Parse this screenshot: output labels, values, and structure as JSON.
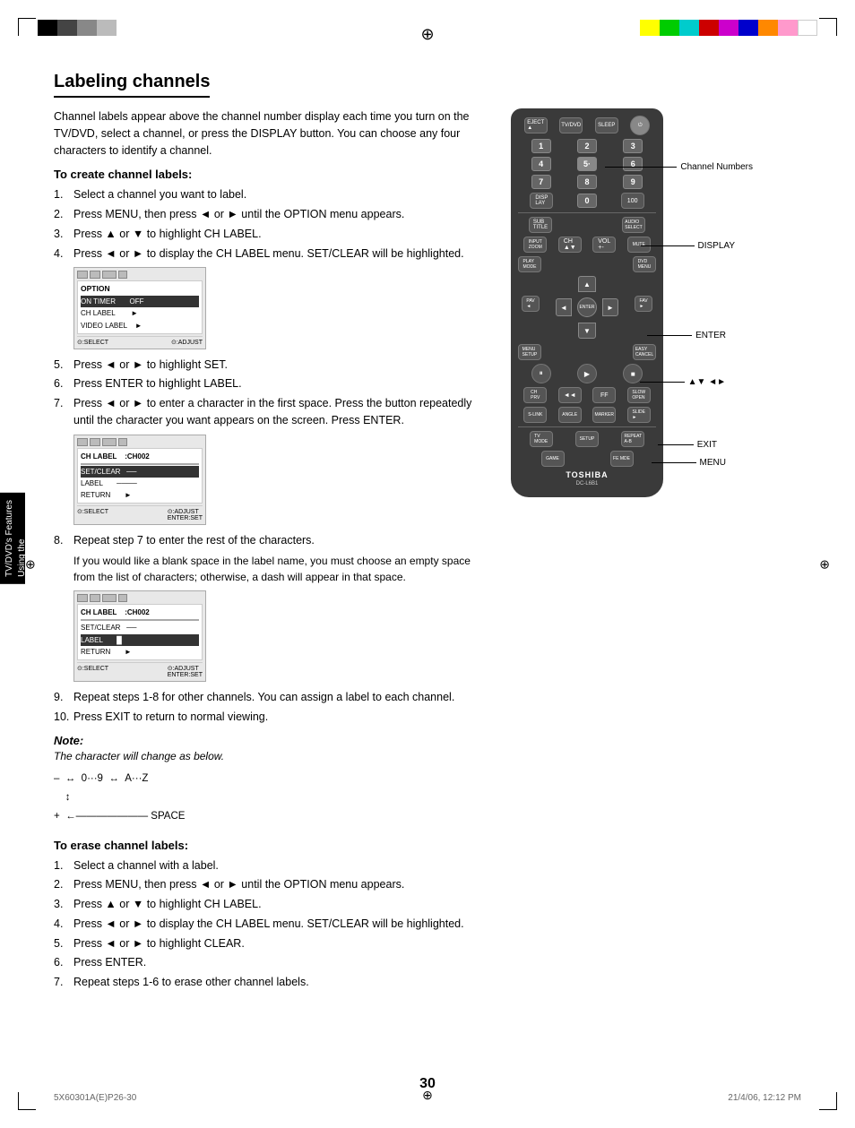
{
  "page": {
    "title": "Labeling channels",
    "number": "30",
    "footer_left": "5X60301A(E)P26-30",
    "footer_center_page": "30",
    "footer_right": "21/4/06, 12:12 PM"
  },
  "intro": {
    "text": "Channel labels appear above the channel number display each time you turn on the TV/DVD, select a channel, or press the DISPLAY button. You can choose any four characters to identify a channel."
  },
  "create_section": {
    "heading": "To create channel labels:",
    "steps": [
      "Select a channel you want to label.",
      "Press MENU, then press ◄ or ► until the OPTION menu appears.",
      "Press ▲ or ▼ to highlight CH LABEL.",
      "Press ◄ or ► to display the CH LABEL menu. SET/CLEAR will be highlighted.",
      "Press ◄ or ► to highlight SET.",
      "Press ENTER to highlight LABEL.",
      "Press ◄ or ► to enter a character in the first space. Press the button repeatedly until the character you want appears on the screen. Press ENTER.",
      "Repeat step 7 to enter the rest of the characters.",
      "Repeat steps 1-8 for other channels. You can assign a label to each channel.",
      "Press EXIT to return to normal viewing."
    ],
    "step8_extra": "If you would like a blank space in the label name, you must choose an empty space from the list of characters; otherwise, a dash will appear in that space."
  },
  "note": {
    "title": "Note:",
    "text": "The character will change as below."
  },
  "char_diagram": {
    "line1": "–  ↔  0···9  ↔  A···Z",
    "line2": "↕",
    "line3": "+ ←———————— SPACE"
  },
  "erase_section": {
    "heading": "To erase channel labels:",
    "steps": [
      "Select a channel with a label.",
      "Press MENU, then press ◄ or ► until the OPTION menu appears.",
      "Press ▲ or ▼ to highlight CH LABEL.",
      "Press ◄ or ► to display the CH LABEL menu. SET/CLEAR will be highlighted.",
      "Press ◄ or ► to highlight CLEAR.",
      "Press ENTER.",
      "Repeat steps 1-6 to erase other channel labels."
    ]
  },
  "sidebar": {
    "line1": "Using the",
    "line2": "TV/DVD's Features"
  },
  "remote": {
    "brand": "TOSHIBA",
    "model": "DC-L6B1",
    "labels": {
      "channel_numbers": "Channel Numbers",
      "display": "DISPLAY",
      "enter": "ENTER",
      "nav": "▲▼ ◄►",
      "exit": "EXIT",
      "menu": "MENU"
    }
  },
  "color_bars_top_right": [
    "#ffff00",
    "#00ff00",
    "#00ffff",
    "#ff0000",
    "#ff00ff",
    "#0000ff",
    "#ff8800",
    "#ff66cc",
    "#ffffff"
  ],
  "color_bars_top_left": [
    "#000000",
    "#444444",
    "#888888",
    "#bbbbbb"
  ]
}
